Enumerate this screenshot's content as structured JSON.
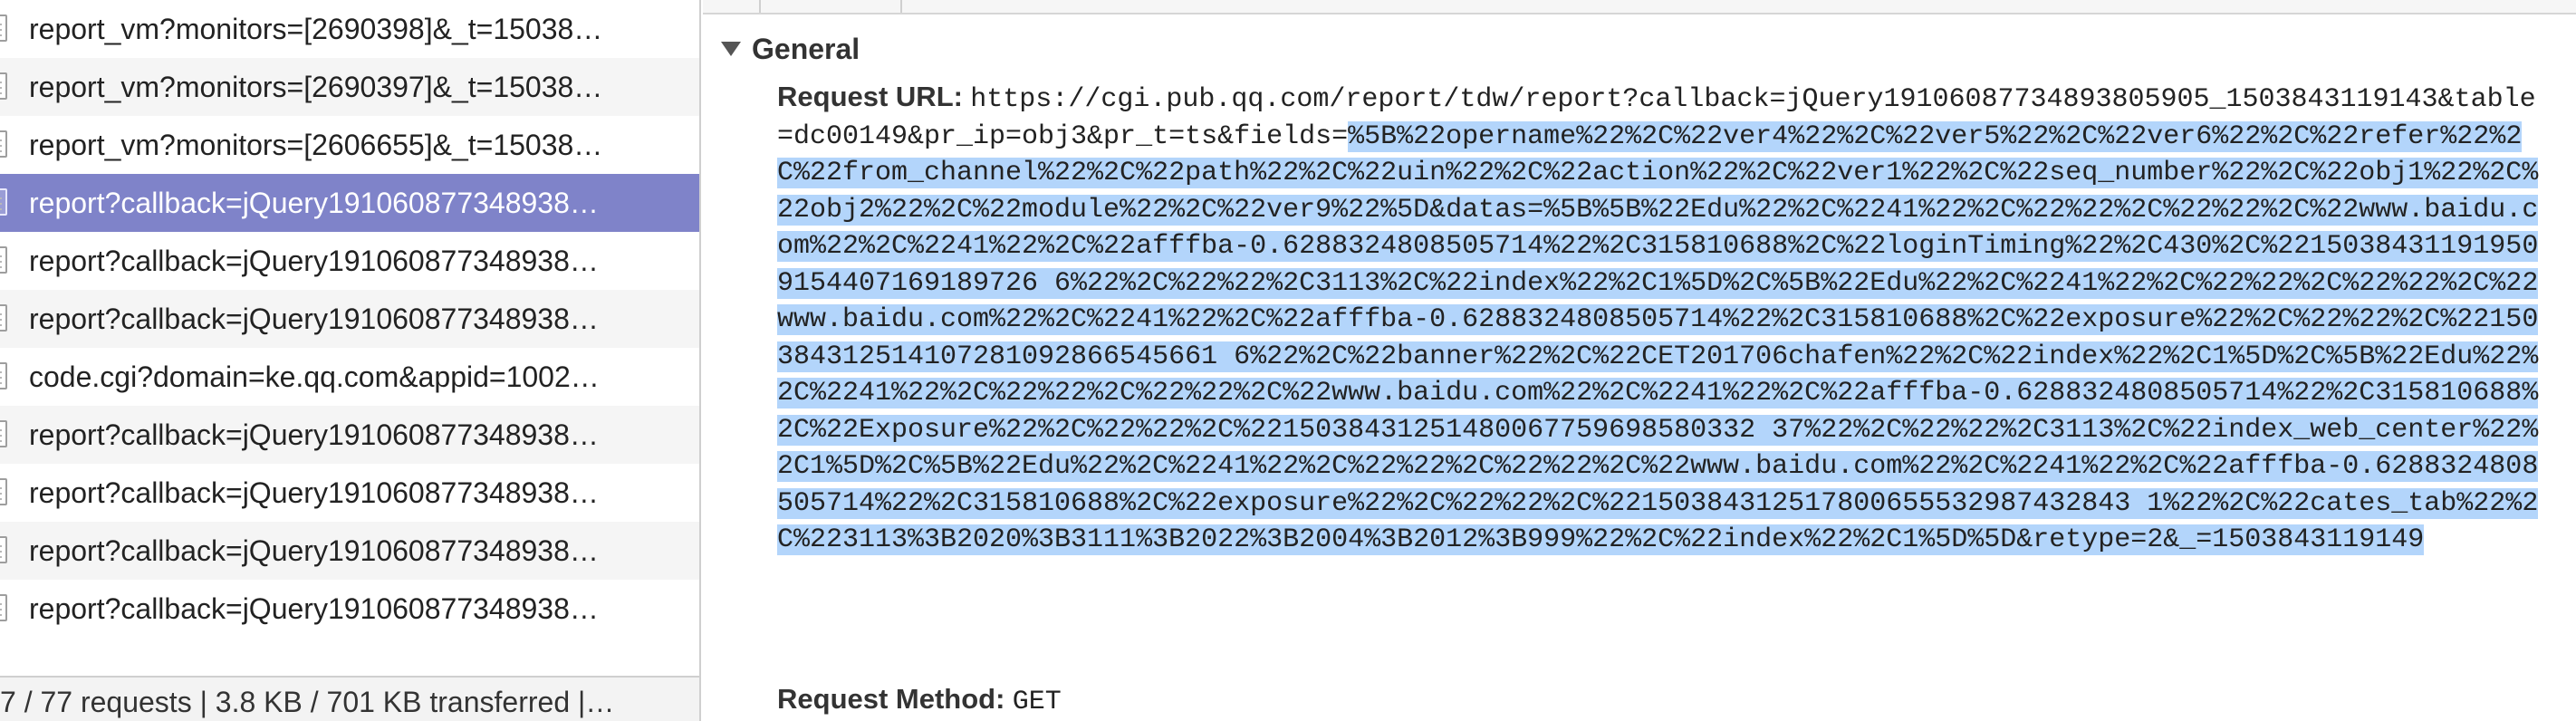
{
  "requests": [
    {
      "name": "report_vm?monitors=[2690398]&_t=15038…",
      "selected": false,
      "alt": false
    },
    {
      "name": "report_vm?monitors=[2690397]&_t=15038…",
      "selected": false,
      "alt": true
    },
    {
      "name": "report_vm?monitors=[2606655]&_t=15038…",
      "selected": false,
      "alt": false
    },
    {
      "name": "report?callback=jQuery191060877348938…",
      "selected": true,
      "alt": true
    },
    {
      "name": "report?callback=jQuery191060877348938…",
      "selected": false,
      "alt": false
    },
    {
      "name": "report?callback=jQuery191060877348938…",
      "selected": false,
      "alt": true
    },
    {
      "name": "code.cgi?domain=ke.qq.com&appid=1002…",
      "selected": false,
      "alt": false
    },
    {
      "name": "report?callback=jQuery191060877348938…",
      "selected": false,
      "alt": true
    },
    {
      "name": "report?callback=jQuery191060877348938…",
      "selected": false,
      "alt": false
    },
    {
      "name": "report?callback=jQuery191060877348938…",
      "selected": false,
      "alt": true
    },
    {
      "name": "report?callback=jQuery191060877348938…",
      "selected": false,
      "alt": false
    }
  ],
  "status_bar": "7 / 77 requests | 3.8 KB / 701 KB transferred |…",
  "general": {
    "title": "General",
    "request_url_label": "Request URL:",
    "request_url_plain": "https://cgi.pub.qq.com/report/tdw/report?callback=jQuery19106087734893805905_1503843119143&table=dc00149&pr_ip=obj3&pr_t=ts&fields=",
    "request_url_selected": "%5B%22opername%22%2C%22ver4%22%2C%22ver5%22%2C%22ver6%22%2C%22refer%22%2C%22from_channel%22%2C%22path%22%2C%22uin%22%2C%22action%22%2C%22ver1%22%2C%22seq_number%22%2C%22obj1%22%2C%22obj2%22%2C%22module%22%2C%22ver9%22%5D&datas=%5B%5B%22Edu%22%2C%2241%22%2C%22%22%2C%22%22%2C%22www.baidu.com%22%2C%2241%22%2C%22afffba-0.6288324808505714%22%2C315810688%2C%22loginTiming%22%2C430%2C%22150384311919509154407169189726 6%22%2C%22%22%2C3113%2C%22index%22%2C1%5D%2C%5B%22Edu%22%2C%2241%22%2C%22%22%2C%22%22%2C%22www.baidu.com%22%2C%2241%22%2C%22afffba-0.6288324808505714%22%2C315810688%2C%22exposure%22%2C%22%22%2C%22150384312514107281092866545661 6%22%2C%22banner%22%2C%22CET201706chafen%22%2C%22index%22%2C1%5D%2C%5B%22Edu%22%2C%2241%22%2C%22%22%2C%22%22%2C%22www.baidu.com%22%2C%2241%22%2C%22afffba-0.6288324808505714%22%2C315810688%2C%22Exposure%22%2C%22%22%2C%2215038431251480067759698580332 37%22%2C%22%22%2C3113%2C%22index_web_center%22%2C1%5D%2C%5B%22Edu%22%2C%2241%22%2C%22%22%2C%22%22%2C%22www.baidu.com%22%2C%2241%22%2C%22afffba-0.6288324808505714%22%2C315810688%2C%22exposure%22%2C%22%22%2C%22150384312517800655532987432843 1%22%2C%22cates_tab%22%2C%223113%3B2020%3B3111%3B2022%3B2004%3B2012%3B999%22%2C%22index%22%2C1%5D%5D&retype=2&_=1503843119149",
    "request_method_label": "Request Method:",
    "request_method_value": "GET"
  },
  "colors": {
    "selected_row": "#7f83c9",
    "text_selection": "#b3d5fb",
    "alt_row": "#f5f5f5"
  },
  "icons": {
    "row_icon": "document-icon",
    "section_toggle": "triangle-down-icon"
  }
}
